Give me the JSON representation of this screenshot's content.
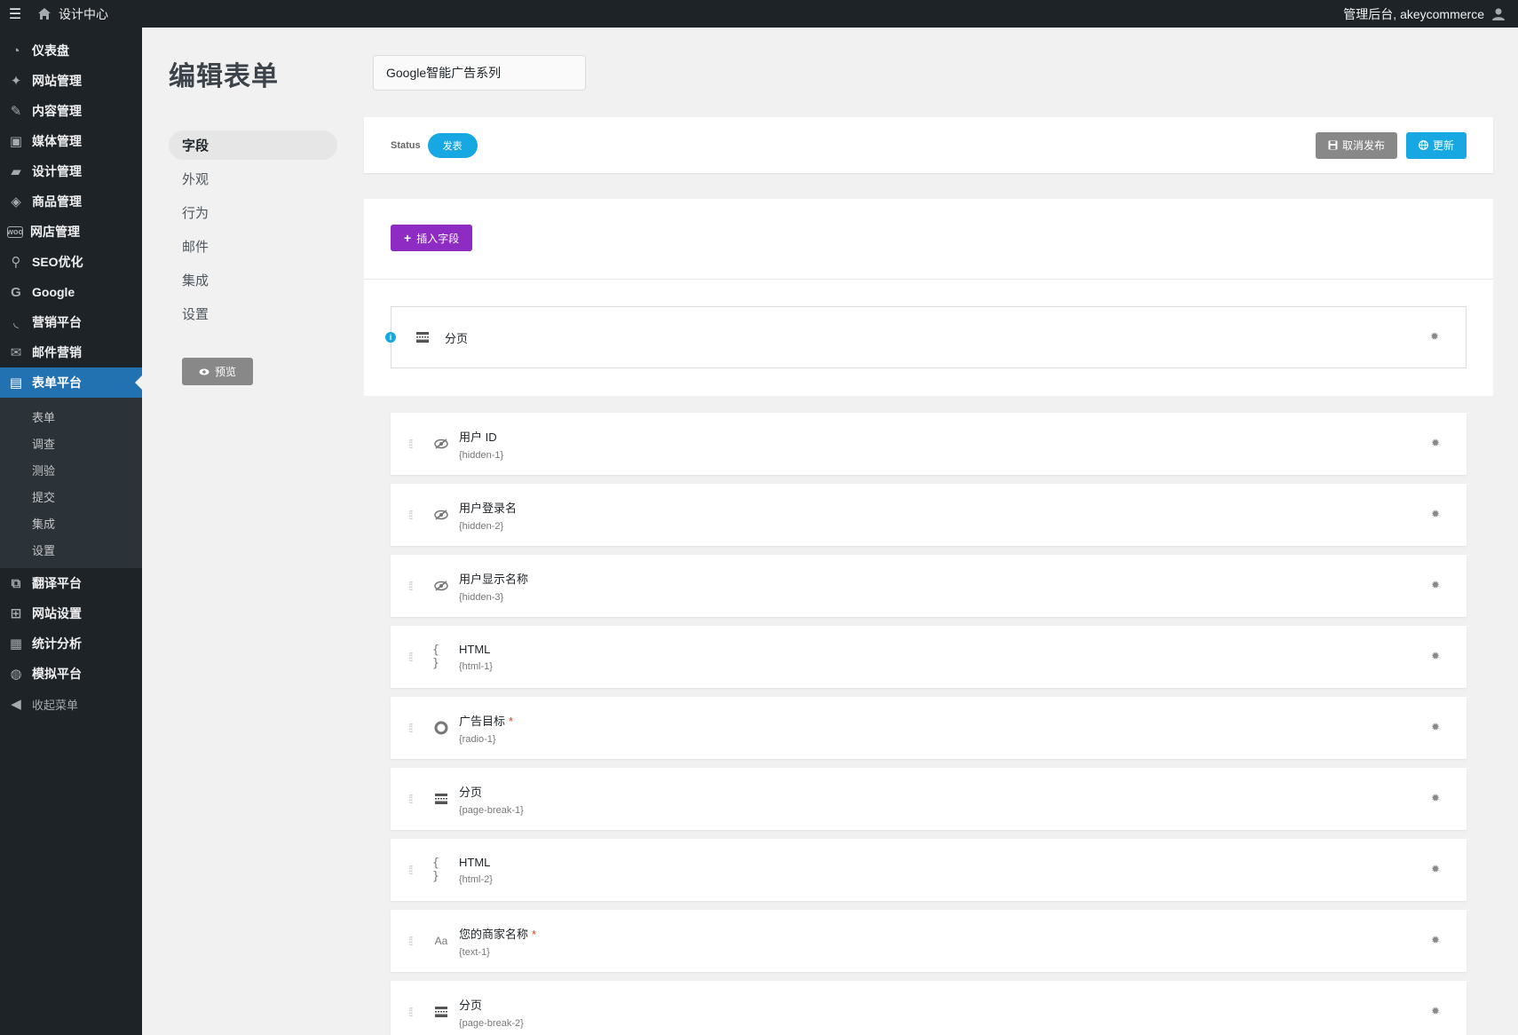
{
  "adminbar": {
    "site_title": "设计中心",
    "user_greeting": "管理后台, akeycommerce"
  },
  "sidebar": {
    "items": [
      {
        "label": "仪表盘",
        "icon": "dashboard-icon"
      },
      {
        "label": "网站管理",
        "icon": "pin-icon"
      },
      {
        "label": "内容管理",
        "icon": "pencil-icon"
      },
      {
        "label": "媒体管理",
        "icon": "media-icon"
      },
      {
        "label": "设计管理",
        "icon": "folder-icon"
      },
      {
        "label": "商品管理",
        "icon": "box-icon"
      },
      {
        "label": "网店管理",
        "icon": "woo-icon"
      },
      {
        "label": "SEO优化",
        "icon": "search-icon"
      },
      {
        "label": "Google",
        "icon": "google-icon"
      },
      {
        "label": "营销平台",
        "icon": "rss-icon"
      },
      {
        "label": "邮件营销",
        "icon": "mail-icon"
      },
      {
        "label": "表单平台",
        "icon": "form-icon"
      }
    ],
    "submenu": [
      "表单",
      "调查",
      "测验",
      "提交",
      "集成",
      "设置"
    ],
    "items_after": [
      {
        "label": "翻译平台",
        "icon": "translate-icon"
      },
      {
        "label": "网站设置",
        "icon": "settings-icon"
      },
      {
        "label": "统计分析",
        "icon": "stats-icon"
      },
      {
        "label": "模拟平台",
        "icon": "globe-icon"
      }
    ],
    "collapse_label": "收起菜单"
  },
  "page": {
    "title": "编辑表单",
    "form_name": "Google智能广告系列"
  },
  "tabs": [
    "字段",
    "外观",
    "行为",
    "邮件",
    "集成",
    "设置"
  ],
  "preview_label": "预览",
  "status": {
    "label": "Status",
    "value": "发表",
    "unpublish_label": "取消发布",
    "update_label": "更新"
  },
  "builder": {
    "insert_label": "插入字段",
    "pagebreak_label": "分页"
  },
  "fields": [
    {
      "label": "用户 ID",
      "slug": "{hidden-1}",
      "icon": "hidden-icon",
      "required": false
    },
    {
      "label": "用户登录名",
      "slug": "{hidden-2}",
      "icon": "hidden-icon",
      "required": false
    },
    {
      "label": "用户显示名称",
      "slug": "{hidden-3}",
      "icon": "hidden-icon",
      "required": false
    },
    {
      "label": "HTML",
      "slug": "{html-1}",
      "icon": "code-icon",
      "required": false
    },
    {
      "label": "广告目标",
      "slug": "{radio-1}",
      "icon": "radio-icon",
      "required": true
    },
    {
      "label": "分页",
      "slug": "{page-break-1}",
      "icon": "page-break-icon",
      "required": false
    },
    {
      "label": "HTML",
      "slug": "{html-2}",
      "icon": "code-icon",
      "required": false
    },
    {
      "label": "您的商家名称",
      "slug": "{text-1}",
      "icon": "text-icon",
      "required": true
    },
    {
      "label": "分页",
      "slug": "{page-break-2}",
      "icon": "page-break-icon",
      "required": false
    }
  ],
  "colors": {
    "admin_dark": "#1d2327",
    "active_blue": "#2271b1",
    "status_blue": "#17a8e3",
    "insert_purple": "#8d2bc3"
  }
}
